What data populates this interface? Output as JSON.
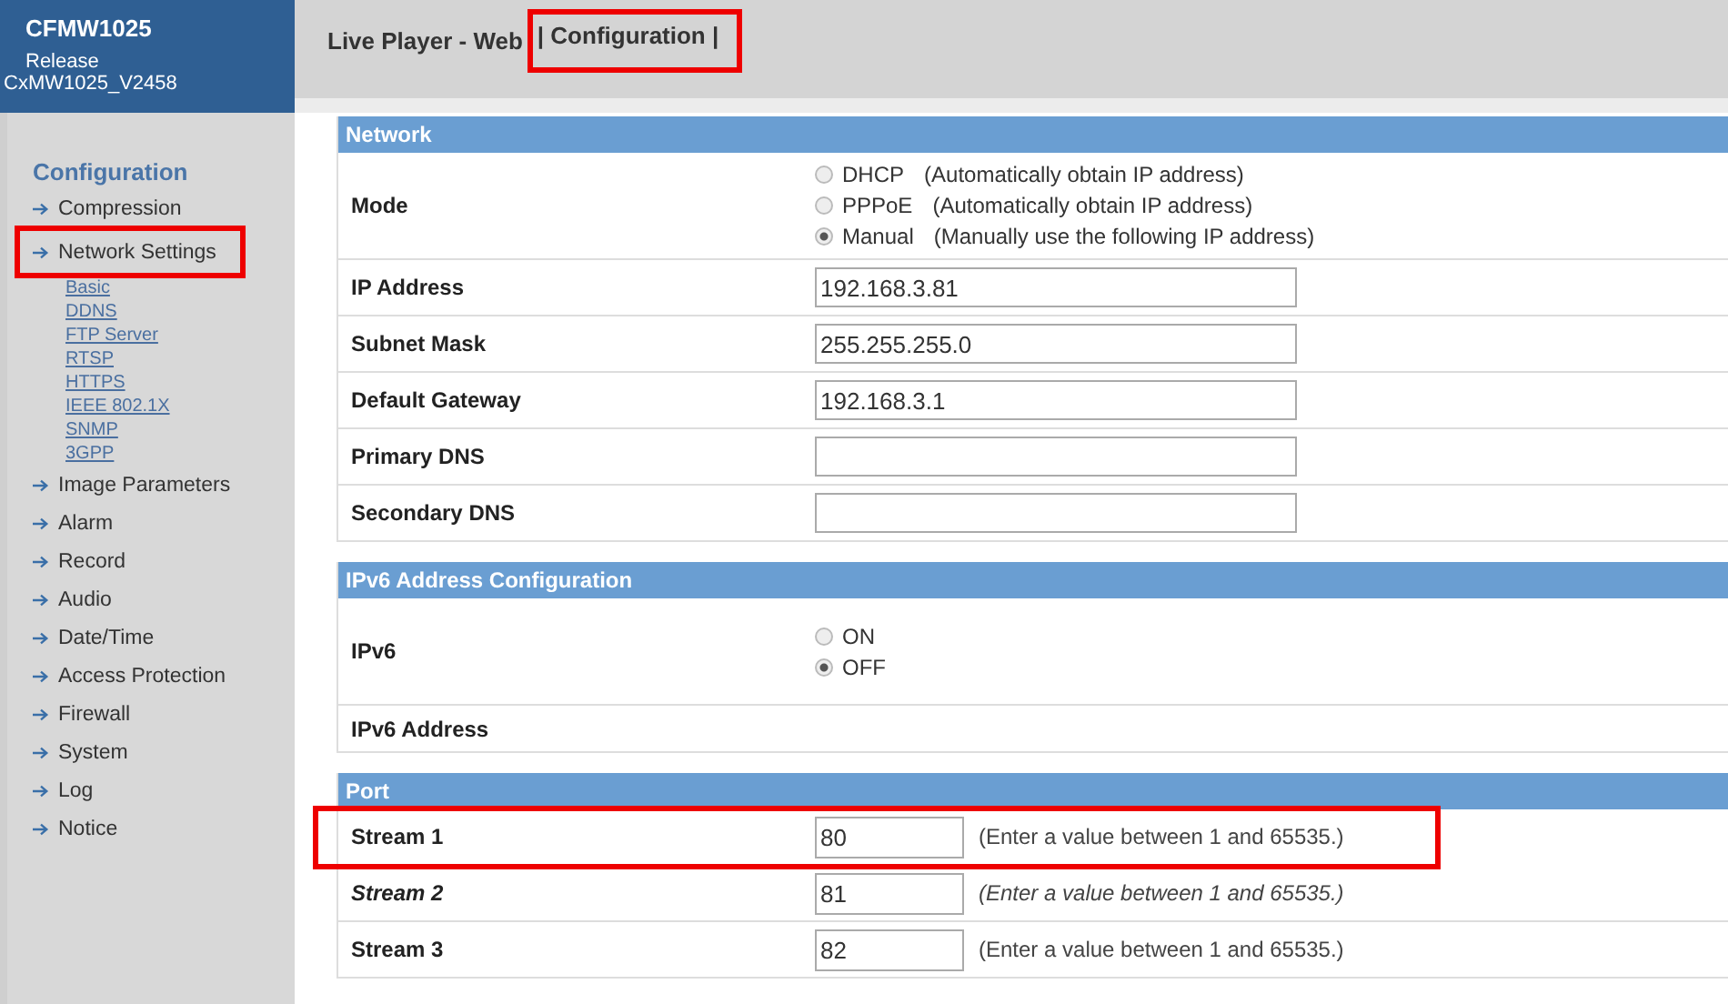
{
  "header": {
    "product": "CFMW1025",
    "release_label": "Release",
    "release": "CxMW1025_V2458",
    "nav": [
      {
        "label": "Live Player - Web",
        "highlighted": false
      },
      {
        "label": "| Configuration |",
        "highlighted": true
      }
    ]
  },
  "sidebar": {
    "title": "Configuration",
    "items": [
      {
        "label": "Compression",
        "highlighted": false
      },
      {
        "label": "Network Settings",
        "highlighted": true,
        "children": [
          {
            "label": "Basic"
          },
          {
            "label": "DDNS"
          },
          {
            "label": "FTP Server"
          },
          {
            "label": "RTSP"
          },
          {
            "label": "HTTPS"
          },
          {
            "label": "IEEE 802.1X"
          },
          {
            "label": "SNMP"
          },
          {
            "label": "3GPP"
          }
        ]
      },
      {
        "label": "Image Parameters",
        "highlighted": false
      },
      {
        "label": "Alarm",
        "highlighted": false
      },
      {
        "label": "Record",
        "highlighted": false
      },
      {
        "label": "Audio",
        "highlighted": false
      },
      {
        "label": "Date/Time",
        "highlighted": false
      },
      {
        "label": "Access Protection",
        "highlighted": false
      },
      {
        "label": "Firewall",
        "highlighted": false
      },
      {
        "label": "System",
        "highlighted": false
      },
      {
        "label": "Log",
        "highlighted": false
      },
      {
        "label": "Notice",
        "highlighted": false
      }
    ]
  },
  "sections": [
    {
      "title": "Network",
      "rows": [
        {
          "kind": "radio",
          "label": "Mode",
          "options": [
            {
              "label": "DHCP",
              "hint": "(Automatically obtain IP address)",
              "selected": false
            },
            {
              "label": "PPPoE",
              "hint": "(Automatically obtain IP address)",
              "selected": false
            },
            {
              "label": "Manual",
              "hint": "(Manually use the following IP address)",
              "selected": true
            }
          ]
        },
        {
          "kind": "input",
          "label": "IP Address",
          "value": "192.168.3.81"
        },
        {
          "kind": "input",
          "label": "Subnet Mask",
          "value": "255.255.255.0"
        },
        {
          "kind": "input",
          "label": "Default Gateway",
          "value": "192.168.3.1"
        },
        {
          "kind": "input",
          "label": "Primary DNS"
        },
        {
          "kind": "input",
          "label": "Secondary DNS"
        }
      ]
    },
    {
      "title": "IPv6 Address Configuration",
      "rows": [
        {
          "kind": "radio",
          "label": "IPv6",
          "options": [
            {
              "label": "ON",
              "selected": false
            },
            {
              "label": "OFF",
              "selected": true
            }
          ]
        },
        {
          "kind": "text",
          "label": "IPv6 Address"
        }
      ]
    },
    {
      "title": "Port",
      "rows": [
        {
          "kind": "port",
          "label": "Stream 1",
          "value": "80",
          "hint": "(Enter a value between 1 and 65535.)",
          "italic": false,
          "highlighted": true
        },
        {
          "kind": "port",
          "label": "Stream 2",
          "value": "81",
          "hint": "(Enter a value between 1 and 65535.)",
          "italic": true,
          "highlighted": false
        },
        {
          "kind": "port",
          "label": "Stream 3",
          "value": "82",
          "hint": "(Enter a value between 1 and 65535.)",
          "italic": false,
          "highlighted": false
        }
      ]
    }
  ]
}
